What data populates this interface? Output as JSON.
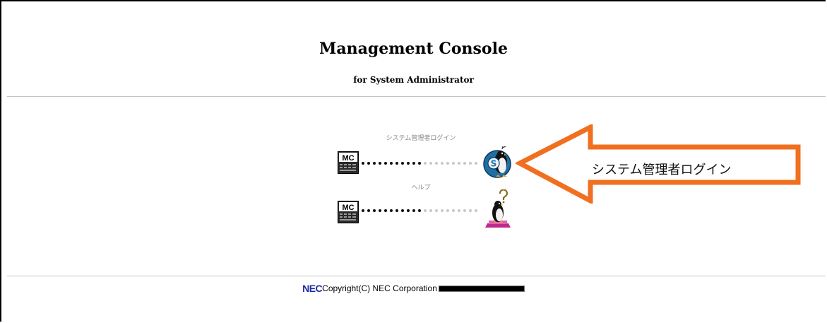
{
  "header": {
    "title": "Management Console",
    "subtitle": "for System Administrator"
  },
  "links": [
    {
      "label": "システム管理者ログイン",
      "mc_icon": "mc-console-icon",
      "target_icon": "penguin-s-icon"
    },
    {
      "label": "ヘルプ",
      "mc_icon": "mc-console-icon",
      "target_icon": "penguin-help-icon"
    }
  ],
  "callout": {
    "text": "システム管理者ログイン",
    "color": "#f07020"
  },
  "footer": {
    "logo": "NEC",
    "copyright": "Copyright(C) NEC Corporation",
    "logo_color": "#1a2ea8"
  }
}
